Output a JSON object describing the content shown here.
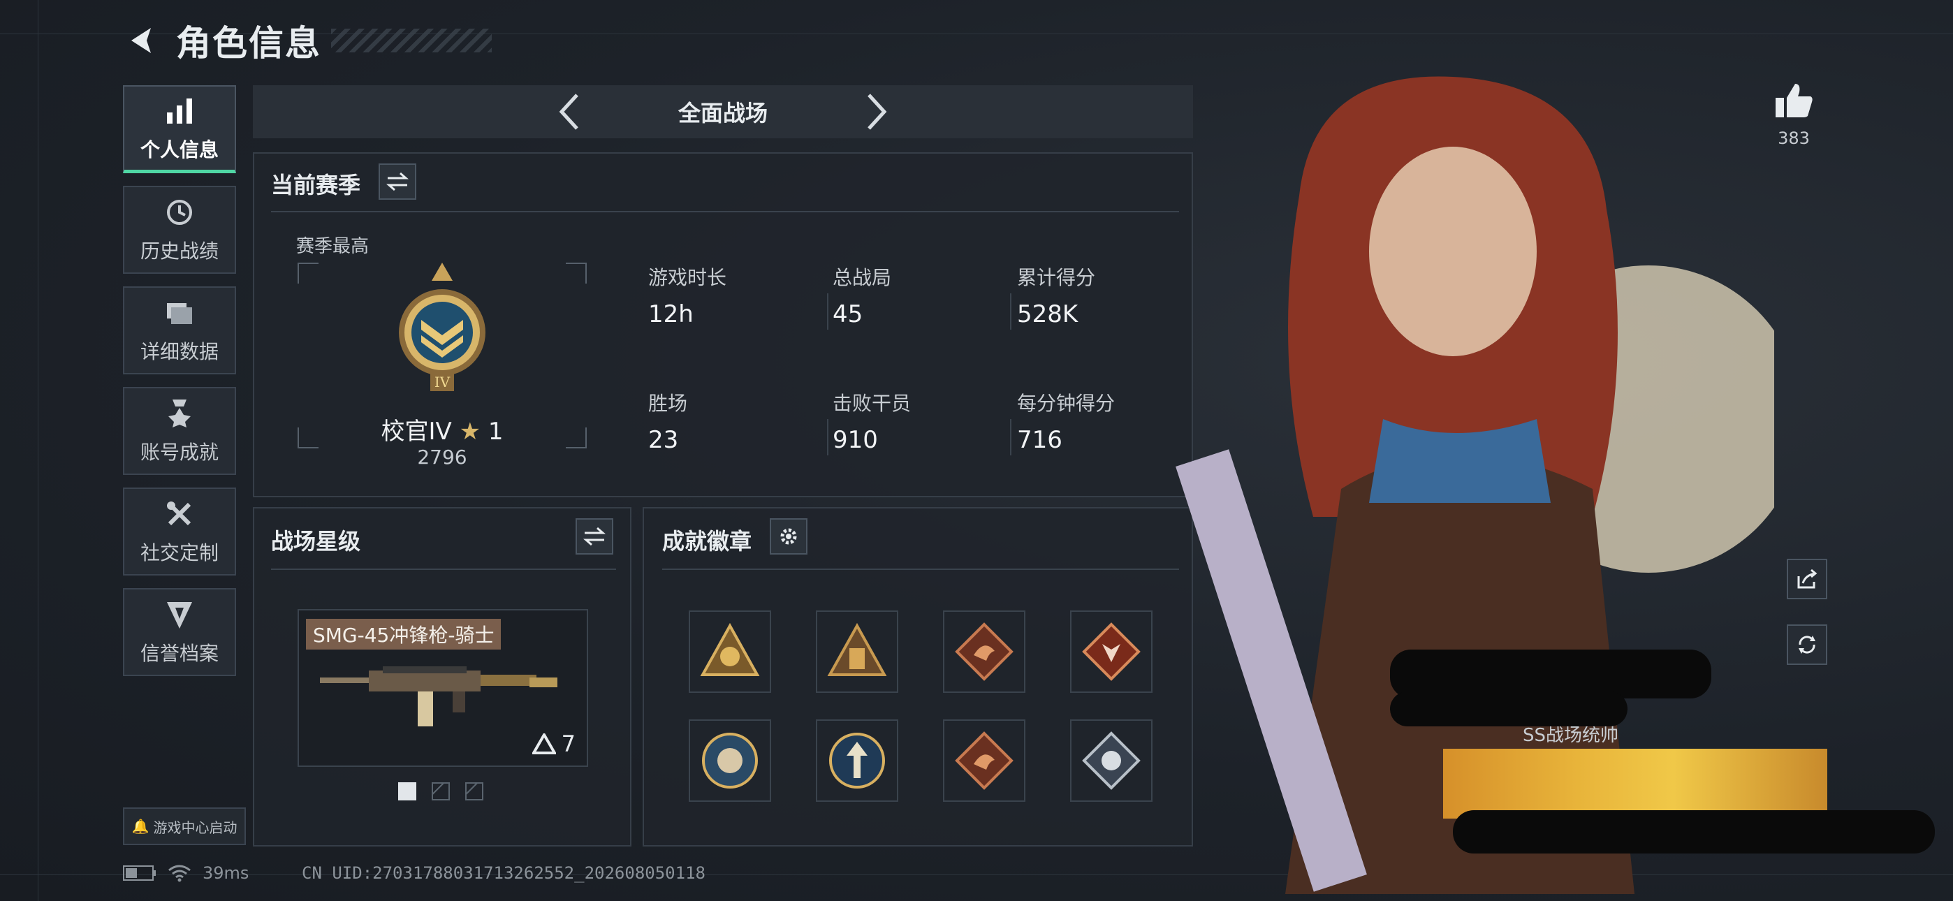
{
  "header": {
    "title": "角色信息"
  },
  "sidebar": {
    "items": [
      {
        "label": "个人信息",
        "icon": "bar-chart-icon",
        "active": true
      },
      {
        "label": "历史战绩",
        "icon": "history-clock-icon",
        "active": false
      },
      {
        "label": "详细数据",
        "icon": "folder-icon",
        "active": false
      },
      {
        "label": "账号成就",
        "icon": "medal-icon",
        "active": false
      },
      {
        "label": "社交定制",
        "icon": "tools-icon",
        "active": false
      },
      {
        "label": "信誉档案",
        "icon": "shield-icon",
        "active": false
      }
    ],
    "launch_label": "游戏中心启动"
  },
  "mode": {
    "label": "全面战场"
  },
  "season": {
    "title": "当前赛季",
    "best_label": "赛季最高",
    "rank_name": "校官IV",
    "rank_stars": "1",
    "rank_score": "2796",
    "stats": [
      {
        "label": "游戏时长",
        "value": "12h"
      },
      {
        "label": "总战局",
        "value": "45"
      },
      {
        "label": "累计得分",
        "value": "528K"
      },
      {
        "label": "胜场",
        "value": "23"
      },
      {
        "label": "击败干员",
        "value": "910"
      },
      {
        "label": "每分钟得分",
        "value": "716"
      }
    ]
  },
  "battlefield_star": {
    "title": "战场星级",
    "weapon_name": "SMG-45冲锋枪-骑士",
    "weapon_level": "7",
    "page_count": 3,
    "active_page": 1
  },
  "badges": {
    "title": "成就徽章",
    "items": [
      "fist-badge-icon",
      "soldiers-badge-icon",
      "dragon-badge-icon",
      "wolf-badge-icon",
      "lion-badge-icon",
      "arrow-badge-icon",
      "dragon-badge-icon",
      "rose-badge-icon"
    ]
  },
  "profile": {
    "like_count": "383",
    "banner_label": "SS战场统帅"
  },
  "status": {
    "ping": "39ms",
    "uid": "CN UID:2703178803171326255​2_202608050118"
  },
  "colors": {
    "accent": "#4fd6a4",
    "panel": "#20252c",
    "border": "#363e48",
    "background": "#1d2229"
  }
}
